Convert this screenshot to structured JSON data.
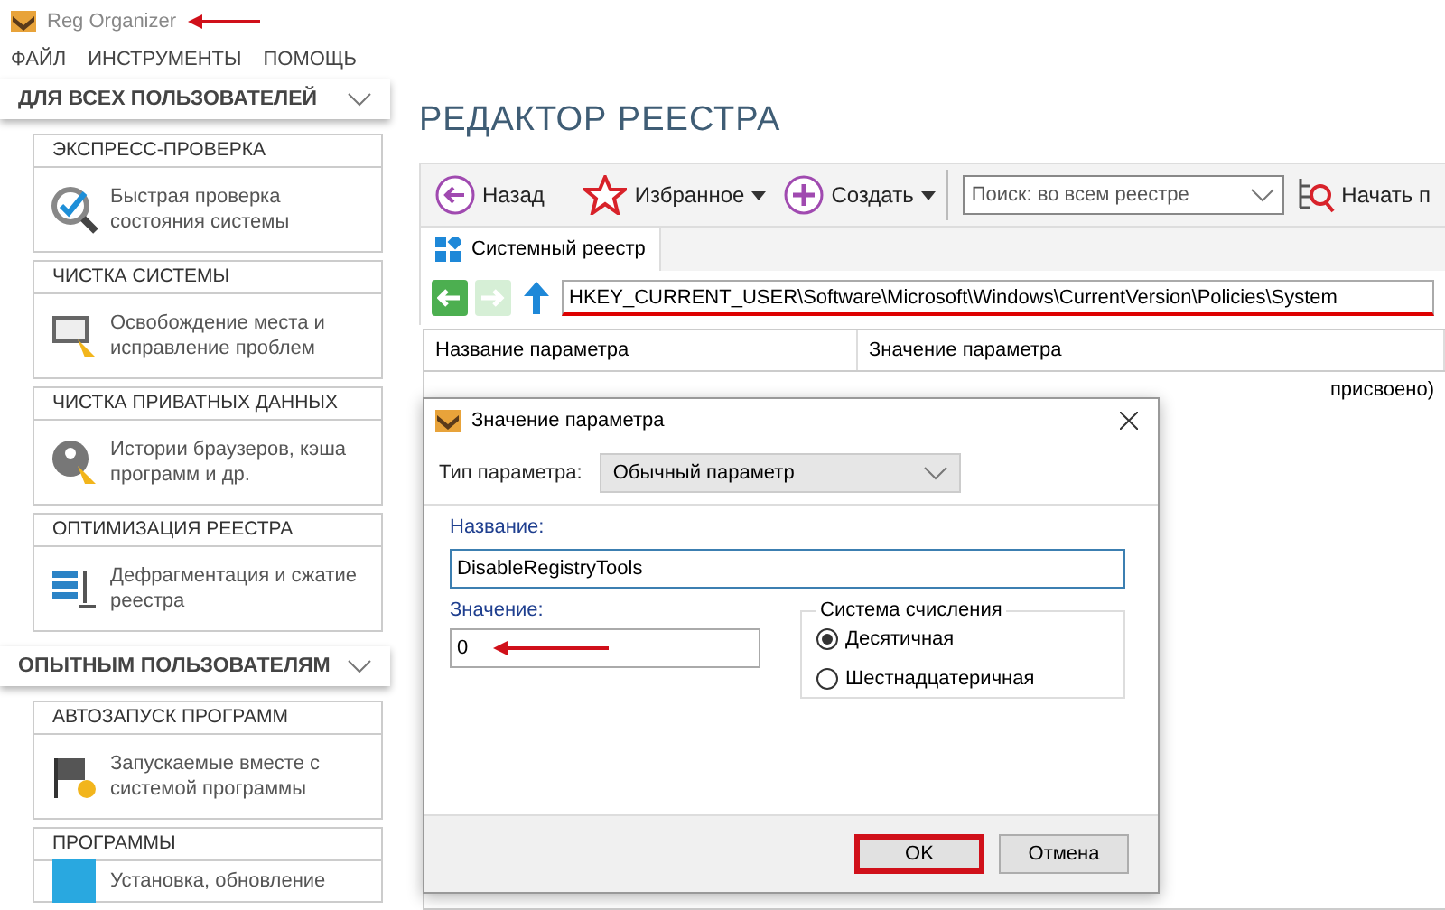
{
  "window": {
    "title": "Reg Organizer"
  },
  "menu": [
    "ФАЙЛ",
    "ИНСТРУМЕНТЫ",
    "ПОМОЩЬ"
  ],
  "sidebar": {
    "sections": [
      {
        "title": "ДЛЯ ВСЕХ ПОЛЬЗОВАТЕЛЕЙ",
        "expanded": true,
        "items": [
          {
            "title": "ЭКСПРЕСС-ПРОВЕРКА",
            "kind": "check",
            "text": "Быстрая проверка состояния системы"
          },
          {
            "title": "ЧИСТКА СИСТЕМЫ",
            "kind": "clean",
            "text": "Освобождение места и исправление проблем"
          },
          {
            "title": "ЧИСТКА ПРИВАТНЫХ ДАННЫХ",
            "kind": "privacy",
            "text": "Истории браузеров, кэша программ и др."
          },
          {
            "title": "ОПТИМИЗАЦИЯ РЕЕСТРА",
            "kind": "defrag",
            "text": "Дефрагментация и сжатие реестра"
          }
        ]
      },
      {
        "title": "ОПЫТНЫМ ПОЛЬЗОВАТЕЛЯМ",
        "expanded": true,
        "items": [
          {
            "title": "АВТОЗАПУСК ПРОГРАММ",
            "kind": "startup",
            "text": "Запускаемые вместе с системой программы"
          },
          {
            "title": "ПРОГРАММЫ",
            "kind": "programs",
            "text": "Установка, обновление"
          }
        ]
      }
    ]
  },
  "main": {
    "heading": "РЕДАКТОР РЕЕСТРА",
    "toolbar": [
      {
        "label": "Назад",
        "kind": "back",
        "has_menu": false
      },
      {
        "label": "Избранное",
        "kind": "favorites",
        "has_menu": true
      },
      {
        "label": "Создать",
        "kind": "create",
        "has_menu": true
      }
    ],
    "search": {
      "value": "Поиск: во всем реестре"
    },
    "start_button": "Начать п",
    "tabs": [
      {
        "label": "Системный реестр",
        "selected": true
      }
    ],
    "path": "HKEY_CURRENT_USER\\Software\\Microsoft\\Windows\\CurrentVersion\\Policies\\System",
    "nav": [
      {
        "kind": "back",
        "disabled": false
      },
      {
        "kind": "forward",
        "disabled": true
      },
      {
        "kind": "up",
        "disabled": false
      }
    ],
    "table": {
      "columns": [
        "Название параметра",
        "Значение параметра"
      ],
      "rows": [
        {
          "cells": [
            "",
            "присвоено)"
          ]
        }
      ]
    }
  },
  "dialog": {
    "title": "Значение параметра",
    "type_label": "Тип параметра:",
    "type_value": "Обычный параметр",
    "name_label": "Название:",
    "name_value": "DisableRegistryTools",
    "value_label": "Значение:",
    "value_value": "0",
    "radix": {
      "title": "Система счисления",
      "options": [
        {
          "label": "Десятичная",
          "selected": true
        },
        {
          "label": "Шестнадцатеричная",
          "selected": false
        }
      ]
    },
    "buttons": [
      {
        "label": "OK",
        "highlighted": true
      },
      {
        "label": "Отмена",
        "highlighted": false
      }
    ]
  }
}
